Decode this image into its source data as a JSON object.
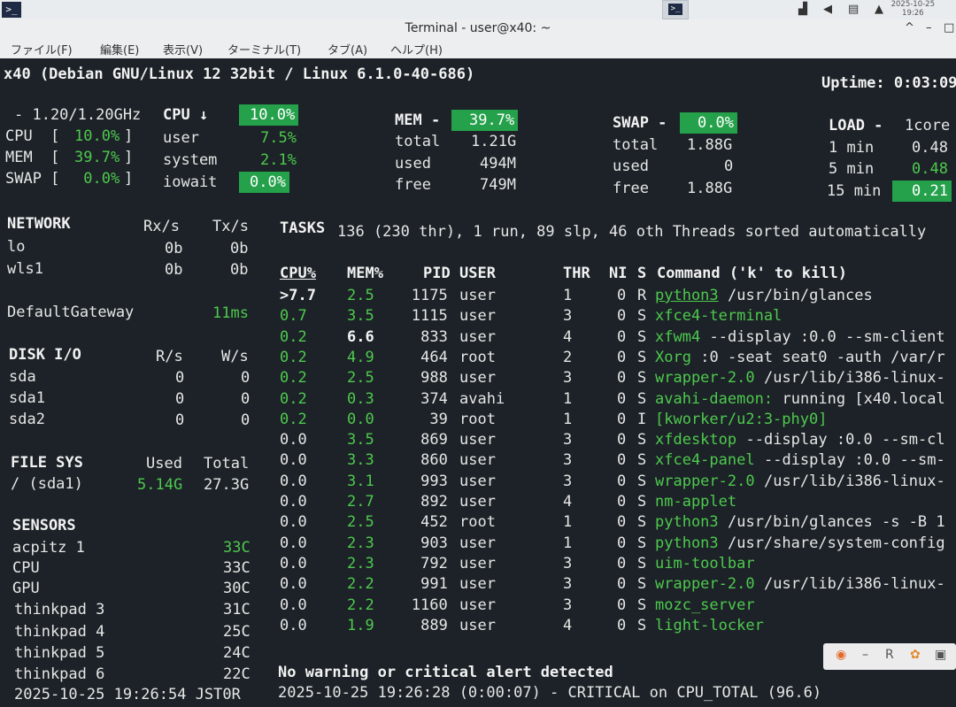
{
  "taskbar": {
    "app_icon": ">_",
    "term_icon": ">_",
    "clock_date": "2025-10-25",
    "clock_time": "19:26",
    "tray_icons": [
      "signal-icon",
      "volume-icon",
      "clipboard-icon",
      "bell-icon"
    ]
  },
  "window": {
    "title": "Terminal - user@x40: ~",
    "controls": [
      "^",
      "–",
      "□"
    ]
  },
  "menu": [
    "ファイル(F)",
    "編集(E)",
    "表示(V)",
    "ターミナル(T)",
    "タブ(A)",
    "ヘルプ(H)"
  ],
  "header": {
    "host": "x40 (Debian GNU/Linux 12 32bit / Linux 6.1.0-40-686)",
    "uptime": "Uptime: 0:03:09"
  },
  "quicklook": {
    "freq": "- 1.20/1.20GHz",
    "cpu_label": "CPU  [",
    "cpu_val": "10.0%",
    "mem_label": "MEM  [",
    "mem_val": "39.7%",
    "swap_label": "SWAP [",
    "swap_val": " 0.0%",
    "close": "]"
  },
  "cpu": {
    "title": "CPU ↓",
    "total": "10.0%",
    "rows": [
      {
        "label": "user",
        "value": "7.5%"
      },
      {
        "label": "system",
        "value": "2.1%"
      },
      {
        "label": "iowait",
        "value": "0.0%"
      }
    ]
  },
  "mem": {
    "title": "MEM -",
    "percent": "39.7%",
    "rows": [
      {
        "label": "total",
        "value": "1.21G"
      },
      {
        "label": "used",
        "value": "494M"
      },
      {
        "label": "free",
        "value": "749M"
      }
    ]
  },
  "swap": {
    "title": "SWAP -",
    "percent": "0.0%",
    "rows": [
      {
        "label": "total",
        "value": "1.88G"
      },
      {
        "label": "used",
        "value": "0"
      },
      {
        "label": "free",
        "value": "1.88G"
      }
    ]
  },
  "load": {
    "title": "LOAD -",
    "cores": "1core",
    "rows": [
      {
        "label": "1 min",
        "value": "0.48"
      },
      {
        "label": "5 min",
        "value": "0.48"
      },
      {
        "label": "15 min",
        "value": "0.21"
      }
    ]
  },
  "network": {
    "title": "NETWORK",
    "rx": "Rx/s",
    "tx": "Tx/s",
    "rows": [
      {
        "name": "lo",
        "rx": "0b",
        "tx": "0b"
      },
      {
        "name": "wls1",
        "rx": "0b",
        "tx": "0b"
      }
    ],
    "gateway_label": "DefaultGateway",
    "gateway_value": "11ms"
  },
  "disk": {
    "title": "DISK I/O",
    "r": "R/s",
    "w": "W/s",
    "rows": [
      {
        "name": "sda",
        "r": "0",
        "w": "0"
      },
      {
        "name": "sda1",
        "r": "0",
        "w": "0"
      },
      {
        "name": "sda2",
        "r": "0",
        "w": "0"
      }
    ]
  },
  "fs": {
    "title": "FILE SYS",
    "used": "Used",
    "total": "Total",
    "rows": [
      {
        "name": "/ (sda1)",
        "used": "5.14G",
        "total": "27.3G"
      }
    ]
  },
  "sensors": {
    "title": "SENSORS",
    "rows": [
      {
        "name": "acpitz 1",
        "value": "33C"
      },
      {
        "name": "CPU",
        "value": "33C"
      },
      {
        "name": "GPU",
        "value": "30C"
      },
      {
        "name": "thinkpad 3",
        "value": "31C"
      },
      {
        "name": "thinkpad 4",
        "value": "25C"
      },
      {
        "name": "thinkpad 5",
        "value": "24C"
      },
      {
        "name": "thinkpad 6",
        "value": "22C"
      }
    ]
  },
  "tasks": {
    "summary_label": "TASKS",
    "summary": "136 (230 thr), 1 run, 89 slp, 46 oth Threads sorted automatically",
    "headers": {
      "cpu": "CPU%",
      "mem": "MEM%",
      "pid": "PID",
      "user": "USER",
      "thr": "THR",
      "ni": "NI",
      "s": "S",
      "cmd": "Command ('k' to kill)"
    },
    "rows": [
      {
        "cpu": ">7.7",
        "mem": "2.5",
        "pid": "1175",
        "user": "user",
        "thr": "1",
        "ni": "0",
        "s": "R",
        "prog": "python3",
        "args": " /usr/bin/glances"
      },
      {
        "cpu": "0.7",
        "mem": "3.5",
        "pid": "1115",
        "user": "user",
        "thr": "3",
        "ni": "0",
        "s": "S",
        "prog": "xfce4-terminal",
        "args": ""
      },
      {
        "cpu": "0.2",
        "mem": "6.6",
        "pid": "833",
        "user": "user",
        "thr": "4",
        "ni": "0",
        "s": "S",
        "prog": "xfwm4",
        "args": " --display :0.0 --sm-client"
      },
      {
        "cpu": "0.2",
        "mem": "4.9",
        "pid": "464",
        "user": "root",
        "thr": "2",
        "ni": "0",
        "s": "S",
        "prog": "Xorg",
        "args": " :0 -seat seat0 -auth /var/r"
      },
      {
        "cpu": "0.2",
        "mem": "2.5",
        "pid": "988",
        "user": "user",
        "thr": "3",
        "ni": "0",
        "s": "S",
        "prog": "wrapper-2.0",
        "args": " /usr/lib/i386-linux-"
      },
      {
        "cpu": "0.2",
        "mem": "0.3",
        "pid": "374",
        "user": "avahi",
        "thr": "1",
        "ni": "0",
        "s": "S",
        "prog": "avahi-daemon:",
        "args": " running [x40.local"
      },
      {
        "cpu": "0.2",
        "mem": "0.0",
        "pid": "39",
        "user": "root",
        "thr": "1",
        "ni": "0",
        "s": "I",
        "prog": "[kworker/u2:3-phy0]",
        "args": ""
      },
      {
        "cpu": "0.0",
        "mem": "3.5",
        "pid": "869",
        "user": "user",
        "thr": "3",
        "ni": "0",
        "s": "S",
        "prog": "xfdesktop",
        "args": " --display :0.0 --sm-cl"
      },
      {
        "cpu": "0.0",
        "mem": "3.3",
        "pid": "860",
        "user": "user",
        "thr": "3",
        "ni": "0",
        "s": "S",
        "prog": "xfce4-panel",
        "args": " --display :0.0 --sm-"
      },
      {
        "cpu": "0.0",
        "mem": "3.1",
        "pid": "993",
        "user": "user",
        "thr": "3",
        "ni": "0",
        "s": "S",
        "prog": "wrapper-2.0",
        "args": " /usr/lib/i386-linux-"
      },
      {
        "cpu": "0.0",
        "mem": "2.7",
        "pid": "892",
        "user": "user",
        "thr": "4",
        "ni": "0",
        "s": "S",
        "prog": "nm-applet",
        "args": ""
      },
      {
        "cpu": "0.0",
        "mem": "2.5",
        "pid": "452",
        "user": "root",
        "thr": "1",
        "ni": "0",
        "s": "S",
        "prog": "python3",
        "args": " /usr/bin/glances -s -B 1"
      },
      {
        "cpu": "0.0",
        "mem": "2.3",
        "pid": "903",
        "user": "user",
        "thr": "1",
        "ni": "0",
        "s": "S",
        "prog": "python3",
        "args": " /usr/share/system-config"
      },
      {
        "cpu": "0.0",
        "mem": "2.3",
        "pid": "792",
        "user": "user",
        "thr": "3",
        "ni": "0",
        "s": "S",
        "prog": "uim-toolbar",
        "args": ""
      },
      {
        "cpu": "0.0",
        "mem": "2.2",
        "pid": "991",
        "user": "user",
        "thr": "3",
        "ni": "0",
        "s": "S",
        "prog": "wrapper-2.0",
        "args": " /usr/lib/i386-linux-"
      },
      {
        "cpu": "0.0",
        "mem": "2.2",
        "pid": "1160",
        "user": "user",
        "thr": "3",
        "ni": "0",
        "s": "S",
        "prog": "mozc_server",
        "args": ""
      },
      {
        "cpu": "0.0",
        "mem": "1.9",
        "pid": "889",
        "user": "user",
        "thr": "4",
        "ni": "0",
        "s": "S",
        "prog": "light-locker",
        "args": ""
      }
    ]
  },
  "alerts": {
    "status": "No warning or critical alert detected",
    "last": "2025-10-25 19:26:28 (0:00:07) - CRITICAL on CPU_TOTAL (96.6)"
  },
  "footer": {
    "datetime": "2025-10-25 19:26:54 JST0R"
  },
  "float_bar": [
    "◉",
    "–",
    "R",
    "✿",
    "▣"
  ],
  "colors": {
    "accent": "#24a14a",
    "ok": "#4ec94e",
    "bg": "#1c2227"
  }
}
